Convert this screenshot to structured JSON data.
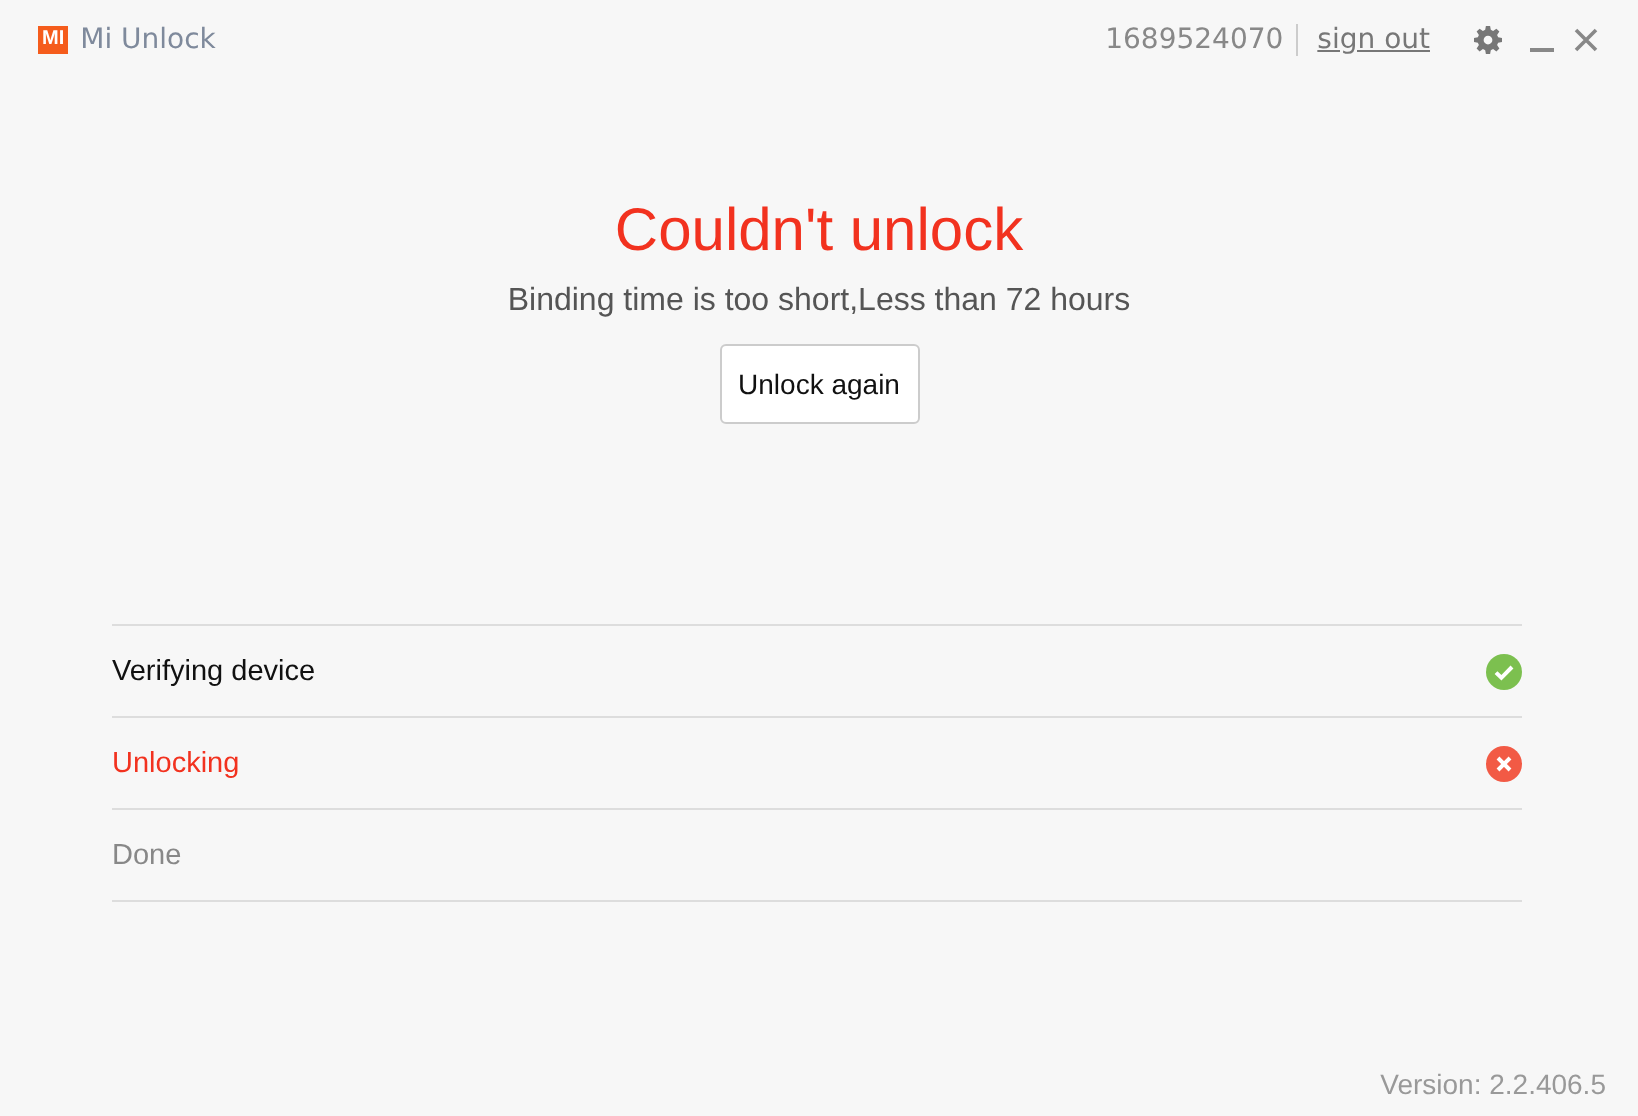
{
  "window": {
    "title": "Mi Unlock",
    "logo": "MI",
    "account": "1689524070",
    "sign_out": "sign out"
  },
  "result": {
    "title": "Couldn't unlock",
    "message": "Binding time is too short,Less than 72 hours",
    "button": "Unlock again"
  },
  "steps": [
    {
      "label": "Verifying device",
      "kind": "done"
    },
    {
      "label": "Unlocking",
      "kind": "failed"
    },
    {
      "label": "Done",
      "kind": "pending"
    }
  ],
  "version": "Version: 2.2.406.5"
}
